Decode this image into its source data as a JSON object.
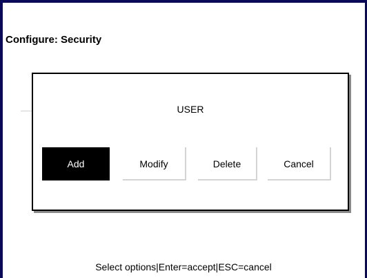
{
  "window": {
    "title": "Configure: Security"
  },
  "dialog": {
    "title": "USER",
    "buttons": [
      {
        "label": "Add",
        "selected": true
      },
      {
        "label": "Modify",
        "selected": false
      },
      {
        "label": "Delete",
        "selected": false
      },
      {
        "label": "Cancel",
        "selected": false
      }
    ]
  },
  "status": {
    "hint": "Select options|Enter=accept|ESC=cancel"
  },
  "colors": {
    "frame": "#0a0a5a",
    "selected_button_bg": "#000000",
    "selected_button_text": "#ffffff"
  }
}
